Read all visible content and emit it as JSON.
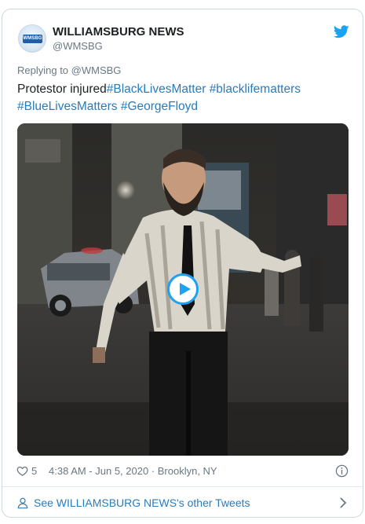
{
  "account": {
    "name": "WILLIAMSBURG NEWS",
    "handle": "@WMSBG",
    "avatar_text": "WMSBG"
  },
  "reply": {
    "text": "Replying to @WMSBG"
  },
  "tweet": {
    "text_plain": "Protestor injured",
    "hashtags": [
      "#BlackLivesMatter",
      "#blacklifematters",
      "#BlueLivesMatters",
      "#GeorgeFloyd"
    ]
  },
  "media": {
    "play_icon": "play-icon"
  },
  "meta": {
    "likes": "5",
    "timestamp": "4:38 AM - Jun 5, 2020 · Brooklyn, NY"
  },
  "footer": {
    "link_text": "See WILLIAMSBURG NEWS's other Tweets"
  },
  "colors": {
    "link": "#2b7bb9",
    "twitter_blue": "#1da1f2",
    "secondary_text": "#697882",
    "border": "#cfd9de"
  }
}
